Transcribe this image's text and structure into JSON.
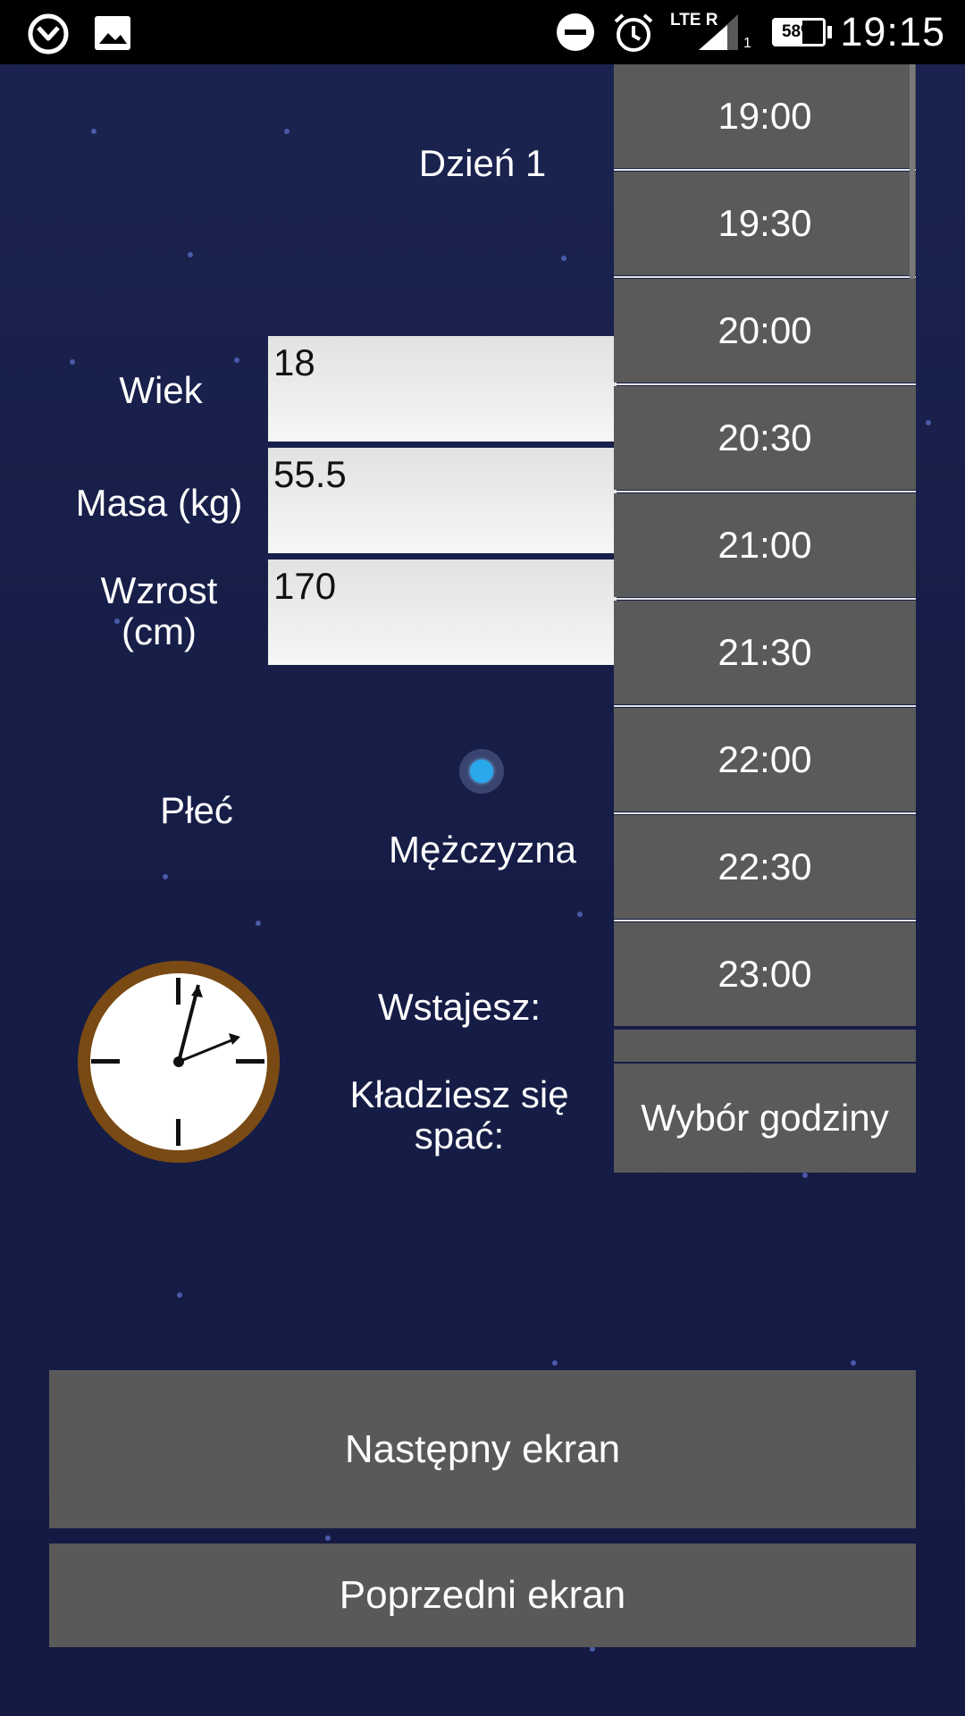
{
  "status_bar": {
    "time": "19:15",
    "battery": "58%",
    "battery_level": 0.58,
    "network": "LTE R",
    "sim_slot": "1",
    "icons": [
      "sleep-app-icon",
      "image-icon",
      "do-not-disturb-icon",
      "alarm-icon",
      "signal-icon",
      "battery-icon"
    ]
  },
  "header": {
    "title": "Dzień 1"
  },
  "form": {
    "age_label": "Wiek",
    "age_value": "18",
    "mass_label": "Masa (kg)",
    "mass_value": "55.5",
    "height_label_line1": "Wzrost",
    "height_label_line2": "(cm)",
    "height_value": "170",
    "sex_label": "Płeć",
    "sex_option": "Mężczyzna",
    "wake_label": "Wstajesz:",
    "sleep_label_line1": "Kładziesz się",
    "sleep_label_line2": "spać:"
  },
  "time_dropdown": {
    "options": [
      "19:00",
      "19:30",
      "20:00",
      "20:30",
      "21:00",
      "21:30",
      "22:00",
      "22:30",
      "23:00"
    ],
    "picker_label": "Wybór godziny"
  },
  "buttons": {
    "next": "Następny ekran",
    "previous": "Poprzedni ekran"
  },
  "colors": {
    "background": "#1b2350",
    "button": "#595959",
    "radio_accent": "#2aa8ec",
    "clock_rim": "#7a4a14"
  }
}
